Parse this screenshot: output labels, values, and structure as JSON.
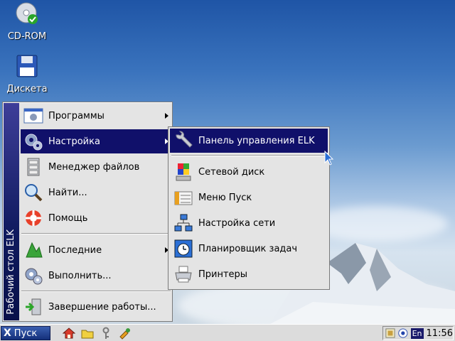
{
  "desktop": {
    "icons": [
      {
        "label": "CD-ROM",
        "icon": "cd-rom-icon"
      },
      {
        "label": "Дискета",
        "icon": "floppy-icon"
      }
    ]
  },
  "start_menu": {
    "sidebar_label": "Рабочий стол ELK",
    "items": [
      {
        "label": "Программы",
        "icon": "programs-icon",
        "has_submenu": true
      },
      {
        "label": "Настройка",
        "icon": "settings-icon",
        "has_submenu": true,
        "active": true
      },
      {
        "label": "Менеджер файлов",
        "icon": "file-manager-icon"
      },
      {
        "label": "Найти...",
        "icon": "search-icon"
      },
      {
        "label": "Помощь",
        "icon": "help-icon"
      },
      {
        "label": "Последние",
        "icon": "recent-icon",
        "has_submenu": true
      },
      {
        "label": "Выполнить...",
        "icon": "run-icon"
      },
      {
        "label": "Завершение работы...",
        "icon": "shutdown-icon"
      }
    ]
  },
  "settings_submenu": {
    "items": [
      {
        "label": "Панель управления ELK",
        "icon": "wrench-icon",
        "active": true
      },
      {
        "label": "Сетевой диск",
        "icon": "network-drive-icon"
      },
      {
        "label": "Меню Пуск",
        "icon": "start-menu-icon"
      },
      {
        "label": "Настройка сети",
        "icon": "network-settings-icon"
      },
      {
        "label": "Планировщик задач",
        "icon": "task-scheduler-icon"
      },
      {
        "label": "Принтеры",
        "icon": "printer-icon"
      }
    ]
  },
  "taskbar": {
    "start_label": "Пуск",
    "start_glyph": "X",
    "language": "En",
    "clock": "11:56"
  },
  "colors": {
    "menu_bg": "#e4e4e4",
    "highlight": "#10106a",
    "sidebar": "#0f1a5e"
  }
}
